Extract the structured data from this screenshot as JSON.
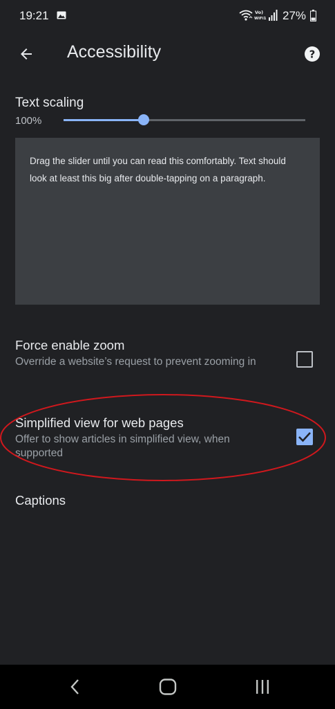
{
  "status_bar": {
    "time": "19:21",
    "network_label": "Vo) WiFi1",
    "battery": "27%",
    "icons": [
      "gallery-icon",
      "wifi-icon",
      "volte-icon",
      "signal-icon",
      "battery-icon"
    ]
  },
  "app_bar": {
    "title": "Accessibility",
    "back_icon": "arrow-back-icon",
    "help_icon": "help-icon"
  },
  "text_scaling": {
    "label": "Text scaling",
    "value": "100%",
    "slider_fraction": 0.33,
    "preview_text": "Drag the slider until you can read this comfortably. Text should look at least this big after double-tapping on a paragraph."
  },
  "settings": {
    "force_zoom": {
      "title": "Force enable zoom",
      "summary": "Override a website’s request to prevent zooming in",
      "checked": false
    },
    "simplified_view": {
      "title": "Simplified view for web pages",
      "summary": "Offer to show articles in simplified view, when supported",
      "checked": true
    },
    "captions": {
      "title": "Captions"
    }
  },
  "annotation": {
    "shape": "ellipse",
    "color": "#d0181d",
    "highlights": "simplified_view"
  },
  "colors": {
    "background": "#202124",
    "accent": "#8ab4f8",
    "preview_background": "#3c3f43",
    "nav_background": "#000000"
  },
  "nav_bar": {
    "icons": [
      "nav-back-icon",
      "nav-home-icon",
      "nav-recents-icon"
    ]
  }
}
